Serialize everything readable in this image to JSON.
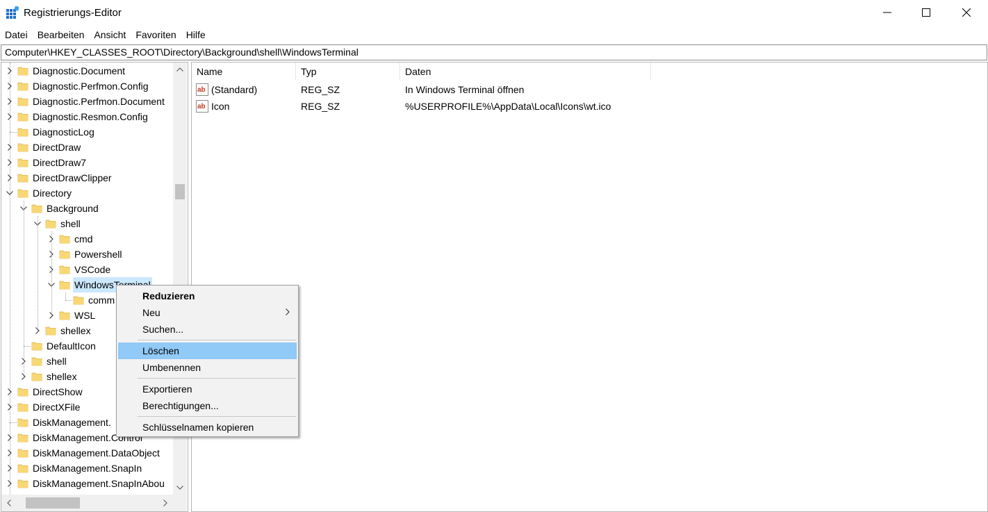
{
  "window": {
    "title": "Registrierungs-Editor"
  },
  "menubar": {
    "items": [
      "Datei",
      "Bearbeiten",
      "Ansicht",
      "Favoriten",
      "Hilfe"
    ]
  },
  "address": {
    "path": "Computer\\HKEY_CLASSES_ROOT\\Directory\\Background\\shell\\WindowsTerminal"
  },
  "tree": {
    "items": [
      {
        "label": "Diagnostic.Document",
        "depth": 0,
        "state": "collapsed"
      },
      {
        "label": "Diagnostic.Perfmon.Config",
        "depth": 0,
        "state": "collapsed"
      },
      {
        "label": "Diagnostic.Perfmon.Document",
        "depth": 0,
        "state": "collapsed"
      },
      {
        "label": "Diagnostic.Resmon.Config",
        "depth": 0,
        "state": "collapsed"
      },
      {
        "label": "DiagnosticLog",
        "depth": 0,
        "state": "leaf"
      },
      {
        "label": "DirectDraw",
        "depth": 0,
        "state": "collapsed"
      },
      {
        "label": "DirectDraw7",
        "depth": 0,
        "state": "collapsed"
      },
      {
        "label": "DirectDrawClipper",
        "depth": 0,
        "state": "collapsed"
      },
      {
        "label": "Directory",
        "depth": 0,
        "state": "expanded"
      },
      {
        "label": "Background",
        "depth": 1,
        "state": "expanded"
      },
      {
        "label": "shell",
        "depth": 2,
        "state": "expanded"
      },
      {
        "label": "cmd",
        "depth": 3,
        "state": "collapsed"
      },
      {
        "label": "Powershell",
        "depth": 3,
        "state": "collapsed"
      },
      {
        "label": "VSCode",
        "depth": 3,
        "state": "collapsed"
      },
      {
        "label": "WindowsTerminal",
        "depth": 3,
        "state": "expanded",
        "selected": true
      },
      {
        "label": "comm",
        "depth": 4,
        "state": "leaf"
      },
      {
        "label": "WSL",
        "depth": 3,
        "state": "collapsed"
      },
      {
        "label": "shellex",
        "depth": 2,
        "state": "collapsed"
      },
      {
        "label": "DefaultIcon",
        "depth": 1,
        "state": "leaf"
      },
      {
        "label": "shell",
        "depth": 1,
        "state": "collapsed"
      },
      {
        "label": "shellex",
        "depth": 1,
        "state": "collapsed"
      },
      {
        "label": "DirectShow",
        "depth": 0,
        "state": "collapsed"
      },
      {
        "label": "DirectXFile",
        "depth": 0,
        "state": "collapsed"
      },
      {
        "label": "DiskManagement.",
        "depth": 0,
        "state": "leaf"
      },
      {
        "label": "DiskManagement.Control",
        "depth": 0,
        "state": "collapsed"
      },
      {
        "label": "DiskManagement.DataObject",
        "depth": 0,
        "state": "collapsed"
      },
      {
        "label": "DiskManagement.SnapIn",
        "depth": 0,
        "state": "collapsed"
      },
      {
        "label": "DiskManagement.SnapInAbou",
        "depth": 0,
        "state": "collapsed"
      }
    ]
  },
  "values": {
    "columns": [
      "Name",
      "Typ",
      "Daten"
    ],
    "rows": [
      {
        "name": "(Standard)",
        "type": "REG_SZ",
        "data": "In Windows Terminal öffnen"
      },
      {
        "name": "Icon",
        "type": "REG_SZ",
        "data": "%USERPROFILE%\\AppData\\Local\\Icons\\wt.ico"
      }
    ]
  },
  "context_menu": {
    "items": [
      {
        "label": "Reduzieren",
        "bold": true
      },
      {
        "label": "Neu",
        "submenu": true
      },
      {
        "label": "Suchen..."
      },
      {
        "separator": true
      },
      {
        "label": "Löschen",
        "hover": true
      },
      {
        "label": "Umbenennen"
      },
      {
        "separator": true
      },
      {
        "label": "Exportieren"
      },
      {
        "label": "Berechtigungen..."
      },
      {
        "separator": true
      },
      {
        "label": "Schlüsselnamen kopieren"
      }
    ]
  },
  "colors": {
    "selection": "#cce8ff",
    "menu_hover": "#91c9f7",
    "folder": "#f8d775",
    "folder_dark": "#e0b443",
    "ab_icon": "#c4391d"
  }
}
